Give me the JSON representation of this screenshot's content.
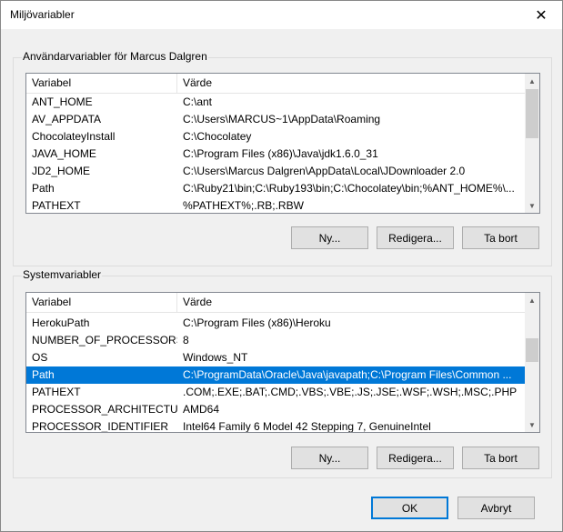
{
  "window": {
    "title": "Miljövariabler",
    "close_glyph": "✕"
  },
  "user_vars": {
    "group_label": "Användarvariabler för Marcus Dalgren",
    "columns": [
      "Variabel",
      "Värde"
    ],
    "rows": [
      [
        "ANT_HOME",
        "C:\\ant"
      ],
      [
        "AV_APPDATA",
        "C:\\Users\\MARCUS~1\\AppData\\Roaming"
      ],
      [
        "ChocolateyInstall",
        "C:\\Chocolatey"
      ],
      [
        "JAVA_HOME",
        "C:\\Program Files (x86)\\Java\\jdk1.6.0_31"
      ],
      [
        "JD2_HOME",
        "C:\\Users\\Marcus Dalgren\\AppData\\Local\\JDownloader 2.0"
      ],
      [
        "Path",
        "C:\\Ruby21\\bin;C:\\Ruby193\\bin;C:\\Chocolatey\\bin;%ANT_HOME%\\..."
      ],
      [
        "PATHEXT",
        "%PATHEXT%;.RB;.RBW"
      ]
    ],
    "buttons": {
      "new": "Ny...",
      "edit": "Redigera...",
      "delete": "Ta bort"
    }
  },
  "system_vars": {
    "group_label": "Systemvariabler",
    "columns": [
      "Variabel",
      "Värde"
    ],
    "rows": [
      [
        "HerokuPath",
        "C:\\Program Files (x86)\\Heroku"
      ],
      [
        "NUMBER_OF_PROCESSORS",
        "8"
      ],
      [
        "OS",
        "Windows_NT"
      ],
      [
        "Path",
        "C:\\ProgramData\\Oracle\\Java\\javapath;C:\\Program Files\\Common ..."
      ],
      [
        "PATHEXT",
        ".COM;.EXE;.BAT;.CMD;.VBS;.VBE;.JS;.JSE;.WSF;.WSH;.MSC;.PHP"
      ],
      [
        "PROCESSOR_ARCHITECTURE",
        "AMD64"
      ],
      [
        "PROCESSOR_IDENTIFIER",
        "Intel64 Family 6 Model 42 Stepping 7, GenuineIntel"
      ]
    ],
    "selected_row": "Path",
    "buttons": {
      "new": "Ny...",
      "edit": "Redigera...",
      "delete": "Ta bort"
    }
  },
  "footer": {
    "ok": "OK",
    "cancel": "Avbryt"
  },
  "colors": {
    "selection": "#0078d7",
    "default_button_border": "#0078d7"
  },
  "icons": {
    "close": "close-icon",
    "scroll_up": "chevron-up-icon",
    "scroll_down": "chevron-down-icon"
  }
}
